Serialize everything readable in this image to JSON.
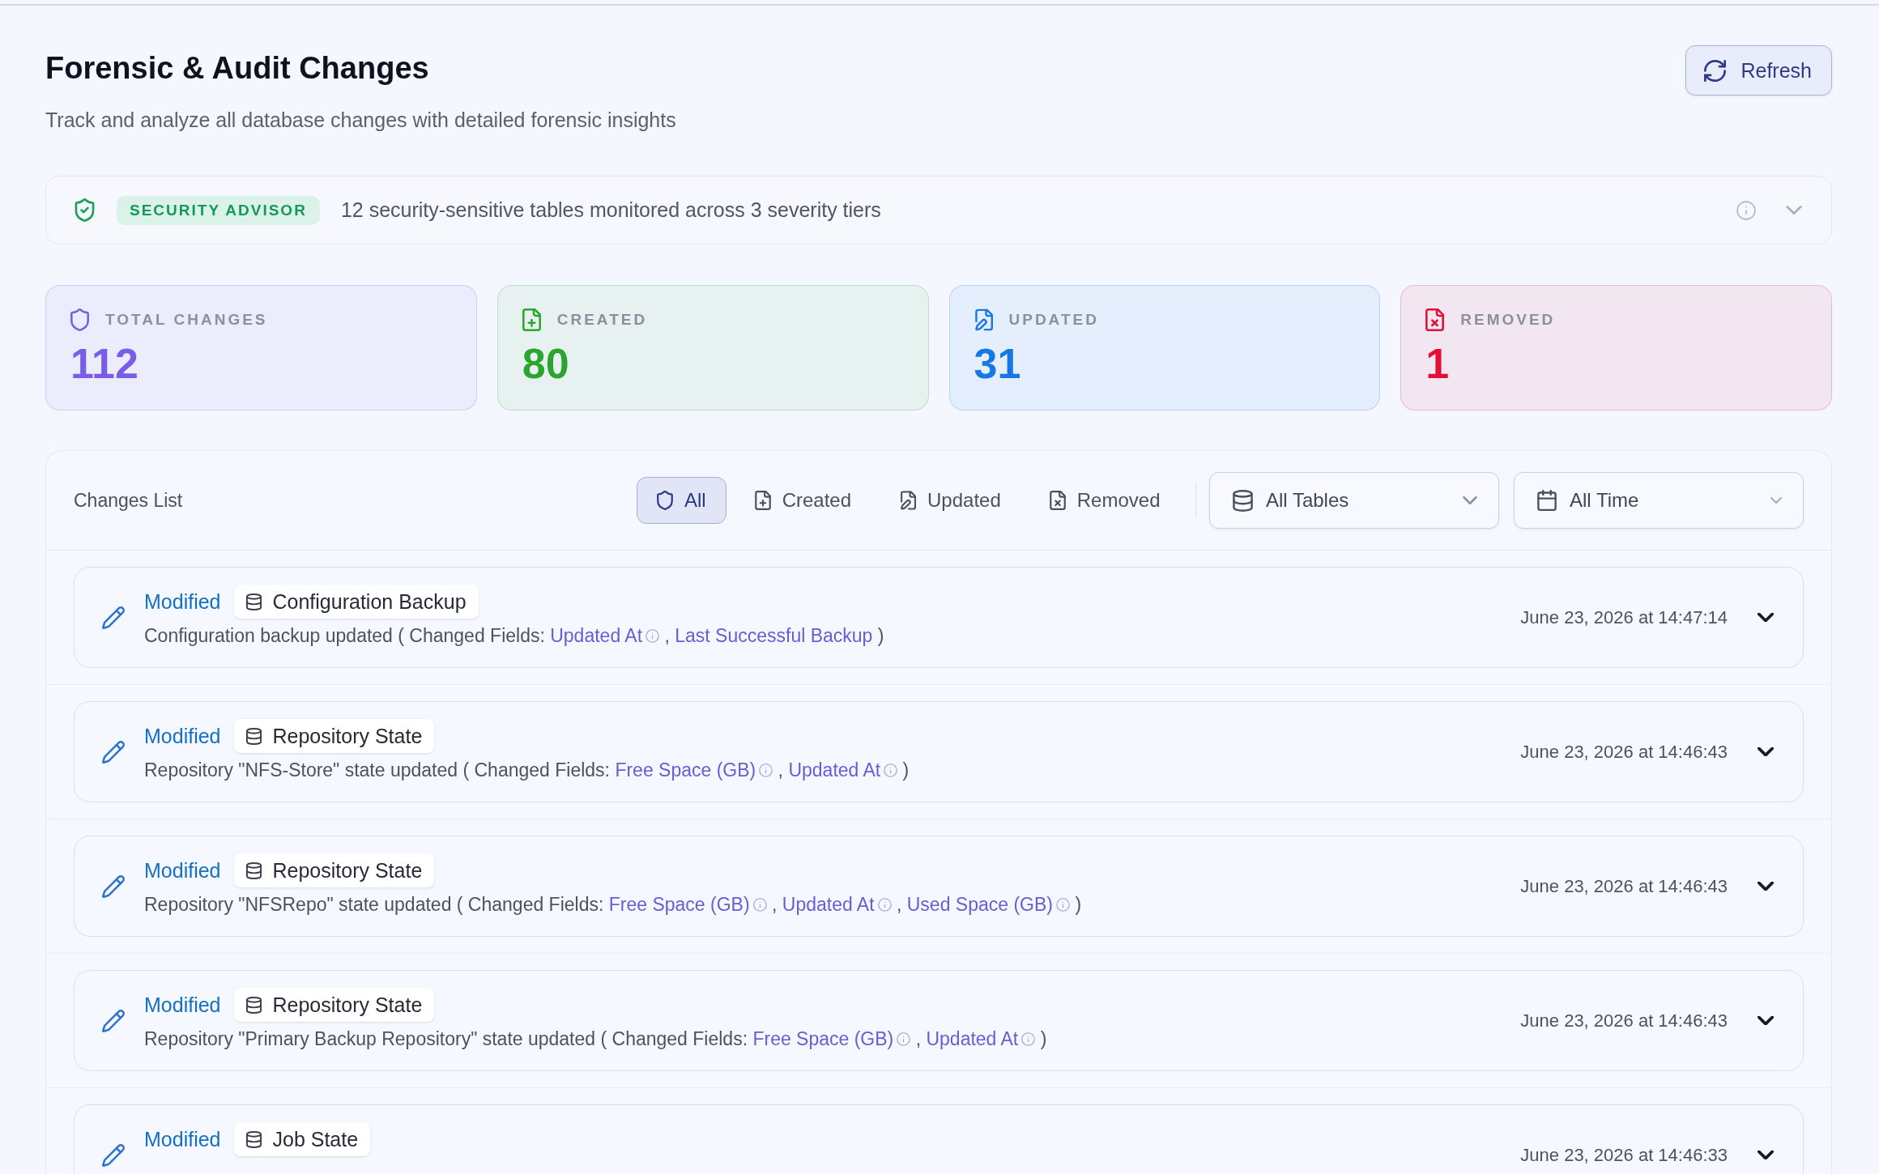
{
  "header": {
    "title": "Forensic & Audit Changes",
    "subtitle": "Track and analyze all database changes with detailed forensic insights",
    "refresh_button": "Refresh"
  },
  "security_advisor": {
    "badge": "SECURITY ADVISOR",
    "text": "12 security-sensitive tables monitored across 3 severity tiers",
    "expanded": false
  },
  "stats": [
    {
      "kind": "total",
      "label": "TOTAL CHANGES",
      "value": "112",
      "color": "#7b5ce8"
    },
    {
      "kind": "created",
      "label": "CREATED",
      "value": "80",
      "color": "#2ba52e"
    },
    {
      "kind": "updated",
      "label": "UPDATED",
      "value": "31",
      "color": "#1677e6"
    },
    {
      "kind": "removed",
      "label": "REMOVED",
      "value": "1",
      "color": "#e0103a"
    }
  ],
  "changes_list": {
    "title": "Changes List",
    "filters": [
      {
        "kind": "all",
        "label": "All",
        "selected": true
      },
      {
        "kind": "created",
        "label": "Created",
        "selected": false
      },
      {
        "kind": "updated",
        "label": "Updated",
        "selected": false
      },
      {
        "kind": "removed",
        "label": "Removed",
        "selected": false
      }
    ],
    "selects": [
      {
        "kind": "tables",
        "value": "All Tables"
      },
      {
        "kind": "time",
        "value": "All Time"
      }
    ],
    "rows": [
      {
        "action": "Modified",
        "table": "Configuration Backup",
        "description": {
          "text": "Configuration backup updated ( Changed Fields:",
          "fields": [
            {
              "name": "Updated At",
              "info": true
            },
            {
              "name": "Last Successful Backup",
              "info": false
            }
          ],
          "separator": ",",
          "end": ")"
        },
        "date": "June 23, 2026 at 14:47:14",
        "expanded": false
      },
      {
        "action": "Modified",
        "table": "Repository State",
        "description": {
          "text": "Repository \"NFS-Store\" state updated ( Changed Fields:",
          "fields": [
            {
              "name": "Free Space (GB)",
              "info": true
            },
            {
              "name": "Updated At",
              "info": true
            }
          ],
          "separator": ",",
          "end": ")"
        },
        "date": "June 23, 2026 at 14:46:43",
        "expanded": false
      },
      {
        "action": "Modified",
        "table": "Repository State",
        "description": {
          "text": "Repository \"NFSRepo\" state updated ( Changed Fields:",
          "fields": [
            {
              "name": "Free Space (GB)",
              "info": true
            },
            {
              "name": "Updated At",
              "info": true
            },
            {
              "name": "Used Space (GB)",
              "info": true
            }
          ],
          "separator": ",",
          "end": ")"
        },
        "date": "June 23, 2026 at 14:46:43",
        "expanded": false
      },
      {
        "action": "Modified",
        "table": "Repository State",
        "description": {
          "text": "Repository \"Primary Backup Repository\" state updated ( Changed Fields:",
          "fields": [
            {
              "name": "Free Space (GB)",
              "info": true
            },
            {
              "name": "Updated At",
              "info": true
            }
          ],
          "separator": ",",
          "end": ")"
        },
        "date": "June 23, 2026 at 14:46:43",
        "expanded": false
      },
      {
        "action": "Modified",
        "table": "Job State",
        "date": "June 23, 2026 at 14:46:33",
        "expanded": false
      }
    ]
  }
}
